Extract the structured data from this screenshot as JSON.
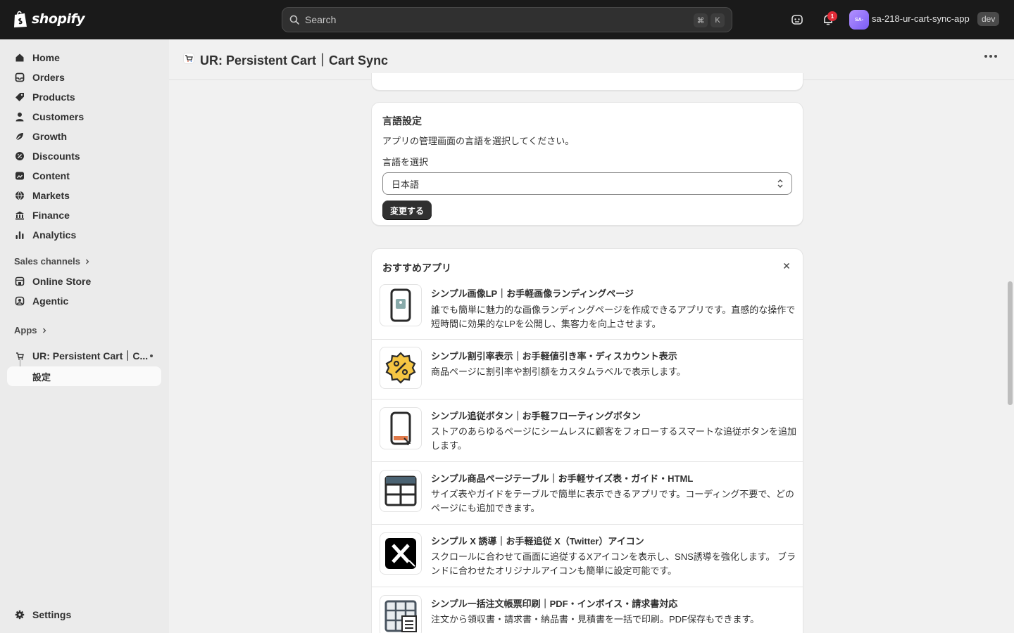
{
  "topbar": {
    "logo_text": "shopify",
    "search_placeholder": "Search",
    "shortcut_cmd": "⌘",
    "shortcut_key": "K",
    "notification_count": "1",
    "avatar_initials": "SA-",
    "store_name": "sa-218-ur-cart-sync-app",
    "env_badge": "dev"
  },
  "sidebar": {
    "items": [
      {
        "label": "Home",
        "icon": "home-icon"
      },
      {
        "label": "Orders",
        "icon": "inbox-icon"
      },
      {
        "label": "Products",
        "icon": "tag-icon"
      },
      {
        "label": "Customers",
        "icon": "person-icon"
      },
      {
        "label": "Growth",
        "icon": "growth-icon"
      },
      {
        "label": "Discounts",
        "icon": "discount-icon"
      },
      {
        "label": "Content",
        "icon": "content-icon"
      },
      {
        "label": "Markets",
        "icon": "globe-icon"
      },
      {
        "label": "Finance",
        "icon": "bank-icon"
      },
      {
        "label": "Analytics",
        "icon": "chart-icon"
      }
    ],
    "sales_channels_label": "Sales channels",
    "channels": [
      {
        "label": "Online Store",
        "icon": "store-icon"
      },
      {
        "label": "Agentic",
        "icon": "agentic-icon"
      }
    ],
    "apps_label": "Apps",
    "app_item": "UR: Persistent Cart｜C...",
    "app_sub_item": "設定",
    "settings_label": "Settings"
  },
  "header": {
    "title": "UR: Persistent Cart｜Cart Sync"
  },
  "language_card": {
    "title": "言語設定",
    "description": "アプリの管理画面の言語を選択してください。",
    "field_label": "言語を選択",
    "selected_value": "日本語",
    "button_label": "変更する"
  },
  "recommended": {
    "title": "おすすめアプリ",
    "apps": [
      {
        "name": "シンプル画像LP｜お手軽画像ランディングページ",
        "desc": "誰でも簡単に魅力的な画像ランディングページを作成できるアプリです。直感的な操作で短時間に効果的なLPを公開し、集客力を向上させます。"
      },
      {
        "name": "シンプル割引率表示｜お手軽値引き率・ディスカウント表示",
        "desc": "商品ページに割引率や割引額をカスタムラベルで表示します。"
      },
      {
        "name": "シンプル追従ボタン｜お手軽フローティングボタン",
        "desc": "ストアのあらゆるページにシームレスに顧客をフォローするスマートな追従ボタンを追加します。"
      },
      {
        "name": "シンプル商品ページテーブル｜お手軽サイズ表・ガイド・HTML",
        "desc": "サイズ表やガイドをテーブルで簡単に表示できるアプリです。コーディング不要で、どのページにも追加できます。"
      },
      {
        "name": "シンプル X 誘導｜お手軽追従 X（Twitter）アイコン",
        "desc": "スクロールに合わせて画面に追従するXアイコンを表示し、SNS誘導を強化します。 ブランドに合わせたオリジナルアイコンも簡単に設定可能です。"
      },
      {
        "name": "シンプル一括注文帳票印刷｜PDF・インボイス・請求書対応",
        "desc": "注文から領収書・請求書・納品書・見積書を一括で印刷。PDF保存もできます。"
      }
    ]
  }
}
